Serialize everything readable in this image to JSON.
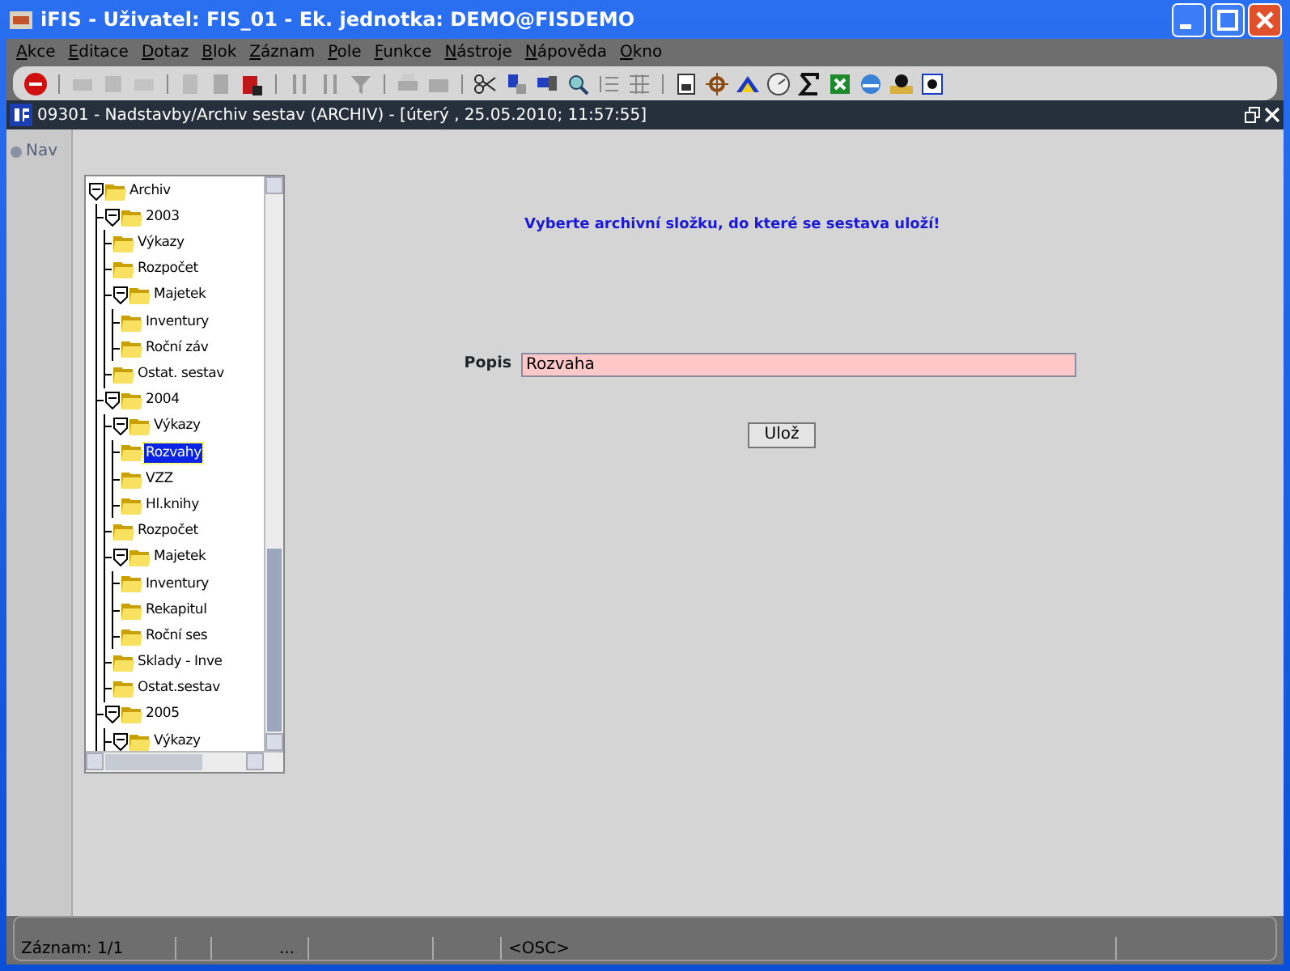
{
  "window": {
    "title": "iFIS - Uživatel: FIS_01 - Ek. jednotka: DEMO@FISDEMO"
  },
  "menu": [
    "Akce",
    "Editace",
    "Dotaz",
    "Blok",
    "Záznam",
    "Pole",
    "Funkce",
    "Nástroje",
    "Nápověda",
    "Okno"
  ],
  "frame": {
    "title": "09301 - Nadstavby/Archiv sestav (ARCHIV) - [úterý  , 25.05.2010; 11:57:55]"
  },
  "nav_button": "Nav",
  "tree": [
    {
      "label": "Archiv",
      "expanded": true,
      "selected": false,
      "children": [
        {
          "label": "2003",
          "expanded": true,
          "selected": false,
          "children": [
            {
              "label": "Výkazy",
              "selected": false
            },
            {
              "label": "Rozpočet",
              "selected": false
            },
            {
              "label": "Majetek",
              "expanded": true,
              "selected": false,
              "children": [
                {
                  "label": "Inventury",
                  "selected": false
                },
                {
                  "label": "Roční záv",
                  "selected": false
                }
              ]
            },
            {
              "label": "Ostat. sestav",
              "selected": false
            }
          ]
        },
        {
          "label": "2004",
          "expanded": true,
          "selected": false,
          "children": [
            {
              "label": "Výkazy",
              "expanded": true,
              "selected": false,
              "children": [
                {
                  "label": "Rozvahy",
                  "selected": true
                },
                {
                  "label": "VZZ",
                  "selected": false
                },
                {
                  "label": "Hl.knihy",
                  "selected": false
                }
              ]
            },
            {
              "label": "Rozpočet",
              "selected": false
            },
            {
              "label": "Majetek",
              "expanded": true,
              "selected": false,
              "children": [
                {
                  "label": "Inventury",
                  "selected": false
                },
                {
                  "label": "Rekapitul",
                  "selected": false
                },
                {
                  "label": "Roční ses",
                  "selected": false
                }
              ]
            },
            {
              "label": "Sklady - Inve",
              "selected": false
            },
            {
              "label": "Ostat.sestav",
              "selected": false
            }
          ]
        },
        {
          "label": "2005",
          "expanded": true,
          "selected": false,
          "children": [
            {
              "label": "Výkazy",
              "expanded": true,
              "selected": false
            }
          ]
        }
      ]
    }
  ],
  "form": {
    "message": "Vyberte archivní složku, do které se sestava uloží!",
    "field": {
      "label": "Popis",
      "value": "Rozvaha"
    },
    "button": "Ulož"
  },
  "status_bar": {
    "record": "Záznam: 1/1",
    "segment_3": "...",
    "segment_6": "<OSC>"
  }
}
